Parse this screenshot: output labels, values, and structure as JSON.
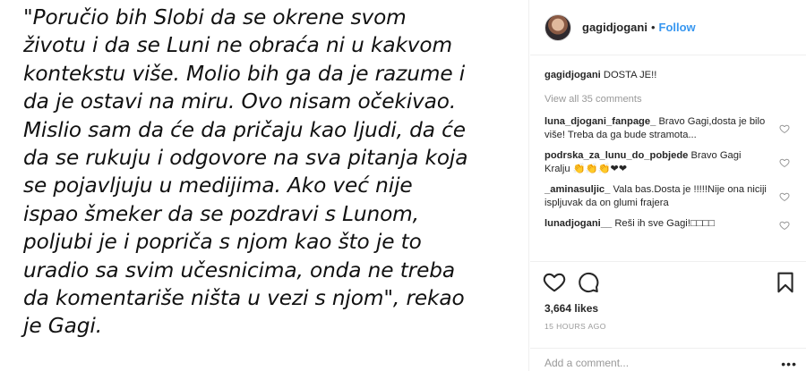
{
  "post": {
    "quote_lines": [
      "\"Poručio bih Slobi da se okrene svom",
      "životu i da se Luni ne obraća ni u kakvom",
      "kontekstu više. Molio bih ga da je razume i",
      "da je ostavi na miru. Ovo nisam očekivao.",
      "Mislio sam da će da pričaju kao ljudi, da će",
      "da se rukuju i odgovore na sva pitanja koja",
      "se pojavljuju u medijima. Ako već nije",
      "ispao šmeker da se pozdravi s Lunom,",
      "poljubi je i popriča s njom kao što je to",
      "uradio sa svim učesnicima, onda ne treba",
      "da komentariše ništa u vezi s njom\", rekao",
      "je Gagi."
    ]
  },
  "header": {
    "username": "gagidjogani",
    "separator": "•",
    "follow_label": "Follow",
    "avatar_icon": "profile-avatar"
  },
  "caption": {
    "username": "gagidjogani",
    "text": "DOSTA JE!!"
  },
  "view_all_label": "View all 35 comments",
  "comments": [
    {
      "username": "luna_djogani_fanpage_",
      "text": "Bravo Gagi,dosta je bilo više! Treba da ga bude stramota..."
    },
    {
      "username": "podrska_za_lunu_do_pobjede",
      "text": "Bravo Gagi Kralju 👏👏👏❤❤"
    },
    {
      "username": "_aminasuljic_",
      "text": "Vala bas.Dosta je !!!!!Nije ona niciji ispljuvak da on glumi frajera"
    },
    {
      "username": "lunadjogani__",
      "text": "Reši ih sve Gagi!□□□□"
    }
  ],
  "actions": {
    "like_icon": "heart-icon",
    "comment_icon": "speech-bubble-icon",
    "save_icon": "bookmark-icon"
  },
  "likes_label": "3,664 likes",
  "timestamp": "15 HOURS AGO",
  "add_comment": {
    "placeholder": "Add a comment...",
    "more_label": "•••"
  },
  "colors": {
    "link_blue": "#3897f0",
    "muted_gray": "#999999",
    "text": "#262626",
    "divider": "#efefef"
  }
}
